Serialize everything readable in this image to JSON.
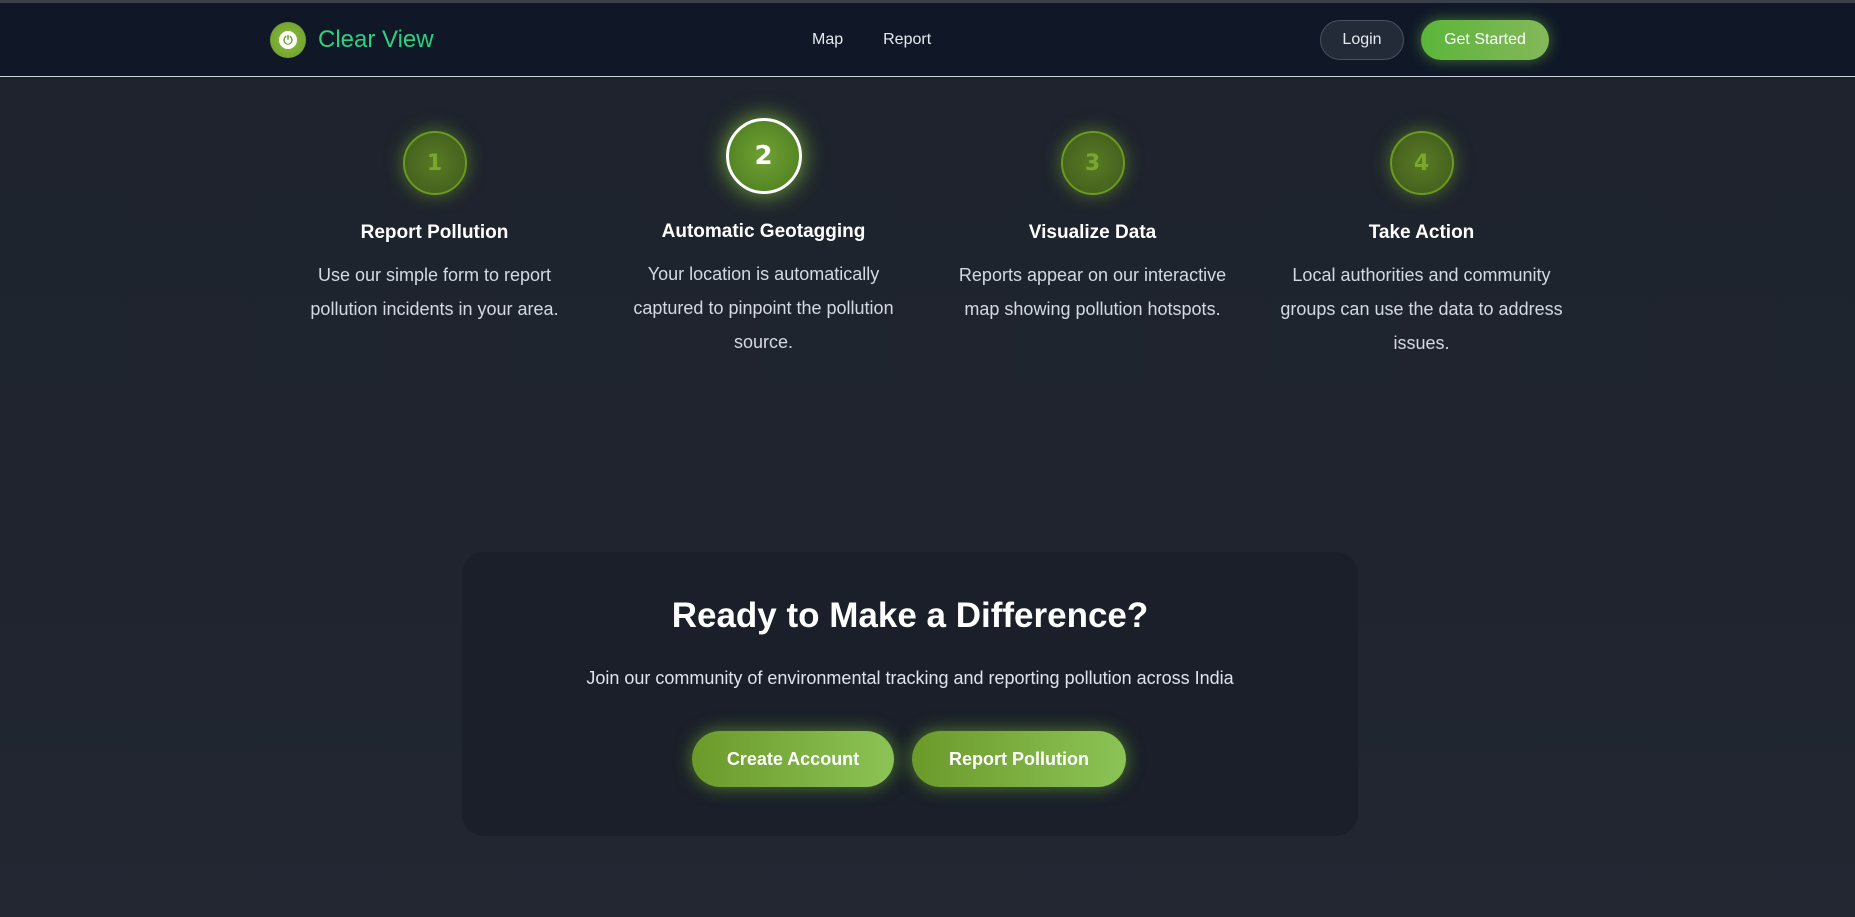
{
  "header": {
    "brand": "Clear View",
    "nav": [
      "Map",
      "Report"
    ],
    "login_label": "Login",
    "get_started_label": "Get Started"
  },
  "steps": [
    {
      "number": "1",
      "title": "Report Pollution",
      "description": "Use our simple form to report pollution incidents in your area."
    },
    {
      "number": "2",
      "title": "Automatic Geotagging",
      "description": "Your location is automatically captured to pinpoint the pollution source."
    },
    {
      "number": "3",
      "title": "Visualize Data",
      "description": "Reports appear on our interactive map showing pollution hotspots."
    },
    {
      "number": "4",
      "title": "Take Action",
      "description": "Local authorities and community groups can use the data to address issues."
    }
  ],
  "cta": {
    "title": "Ready to Make a Difference?",
    "subtitle": "Join our community of environmental tracking and reporting pollution across India",
    "primary_button": "Create Account",
    "secondary_button": "Report Pollution"
  },
  "colors": {
    "brand_green": "#2bd17e",
    "accent_green": "#6b9a2a",
    "header_bg": "#101828"
  },
  "icons": {
    "logo": "leaf-logo-icon"
  }
}
